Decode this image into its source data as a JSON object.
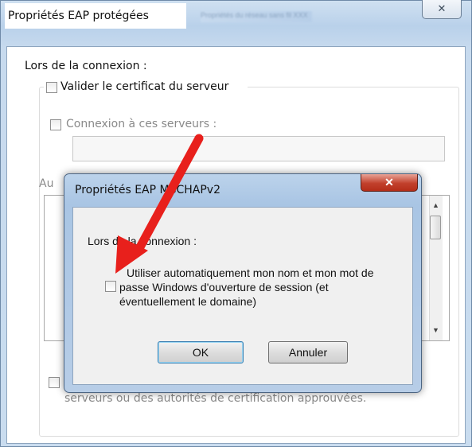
{
  "outer_window": {
    "title": "Propriétés EAP protégées",
    "blurred_title": "Propriétés du réseau sans fil XXX",
    "close_glyph": "✕",
    "connection_label": "Lors de la connexion :",
    "validate_cert_label": "Valider le certificat du serveur",
    "connect_servers_label": "Connexion à ces serveurs :",
    "trusted_ca_label_partial": "Au",
    "footer_line2": "serveurs ou des autorités de certification approuvées."
  },
  "dialog": {
    "title": "Propriétés EAP MSCHAPv2",
    "close_glyph": "✕",
    "connection_label": "Lors de la connexion :",
    "auto_use_label_line1": "Utiliser automatiquement mon nom et mon mot de",
    "auto_use_label_line2": "passe Windows d'ouverture de session (et",
    "auto_use_label_line3": "éventuellement le domaine)",
    "ok_label": "OK",
    "cancel_label": "Annuler"
  },
  "annotation": {
    "arrow_color": "#e8201c"
  }
}
